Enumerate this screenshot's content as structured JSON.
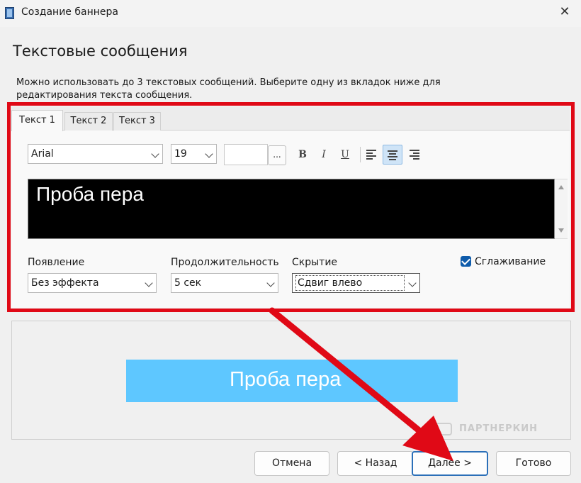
{
  "window": {
    "title": "Создание баннера",
    "close_glyph": "✕",
    "icon": "film-icon"
  },
  "page": {
    "heading": "Текстовые сообщения",
    "description": "Можно использовать до 3 текстовых сообщений. Выберите одну из вкладок ниже для редактирования текста сообщения."
  },
  "tabs": [
    {
      "label": "Текст 1",
      "active": true
    },
    {
      "label": "Текст 2",
      "active": false
    },
    {
      "label": "Текст 3",
      "active": false
    }
  ],
  "toolbar": {
    "font": "Arial",
    "size": "19",
    "color_button": "...",
    "bold": "B",
    "italic": "I",
    "underline": "U",
    "align_selected": "center"
  },
  "editor": {
    "text": "Проба пера",
    "background": "#000000",
    "text_color": "#ffffff"
  },
  "options": {
    "appearance": {
      "label": "Появление",
      "value": "Без эффекта"
    },
    "duration": {
      "label": "Продолжительность",
      "value": "5 сек"
    },
    "hiding": {
      "label": "Скрытие",
      "value": "Сдвиг влево"
    },
    "smoothing": {
      "label": "Сглаживание",
      "checked": true
    }
  },
  "preview": {
    "banner_text": "Проба пера",
    "banner_color": "#5ec7ff",
    "watermark": "ПАРТНЕРКИН"
  },
  "buttons": {
    "cancel": "Отмена",
    "back": "< Назад",
    "next": "Далее >",
    "done": "Готово"
  },
  "annotation": {
    "frame_color": "#e00916",
    "arrow_color": "#e00916"
  }
}
